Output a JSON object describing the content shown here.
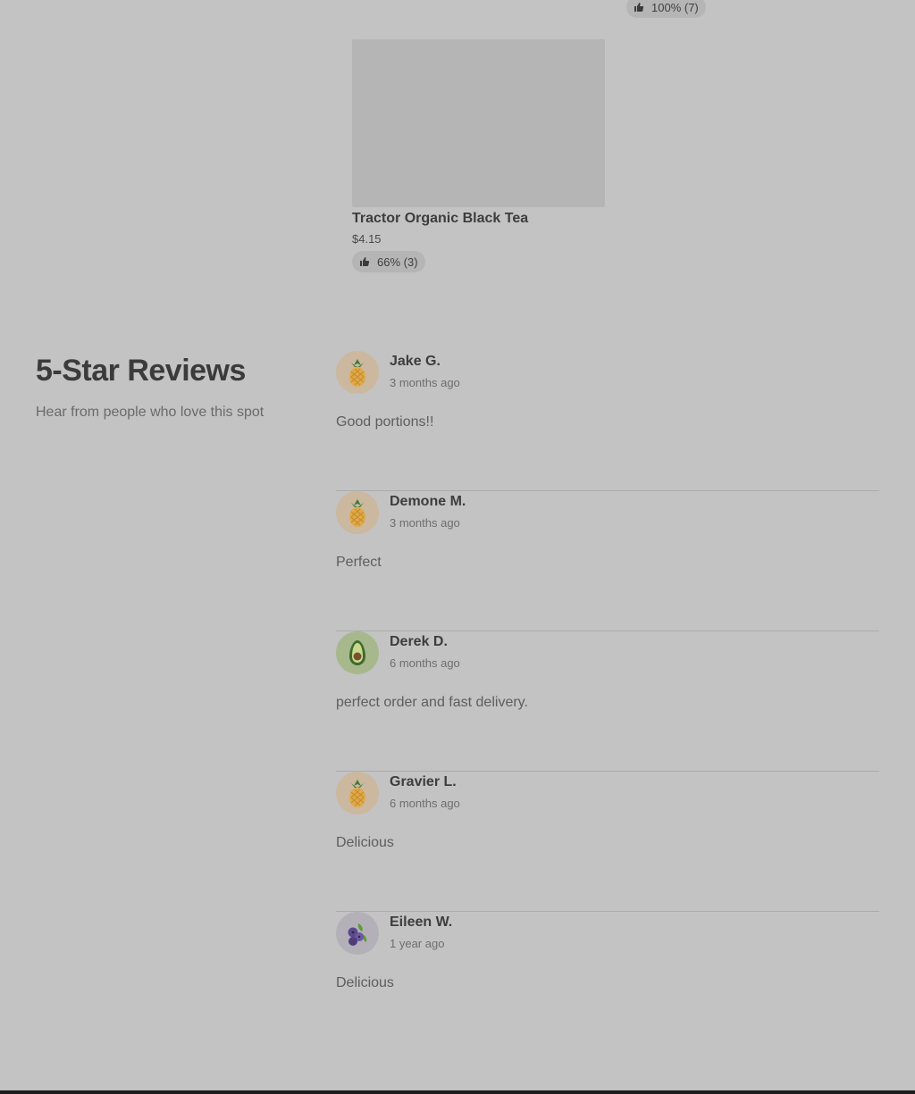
{
  "top_item": {
    "rating_text": "100% (7)"
  },
  "product": {
    "name": "Tractor Organic Black Tea",
    "price": "$4.15",
    "rating_text": "66% (3)"
  },
  "reviews_section": {
    "title": "5-Star Reviews",
    "subtitle": "Hear from people who love this spot",
    "reviews": [
      {
        "name": "Jake G.",
        "ago": "3 months ago",
        "text": "Good portions!!",
        "avatar": "pineapple-icon"
      },
      {
        "name": "Demone M.",
        "ago": "3 months ago",
        "text": "Perfect",
        "avatar": "pineapple-icon"
      },
      {
        "name": "Derek D.",
        "ago": "6 months ago",
        "text": "perfect order and fast delivery.",
        "avatar": "avocado-icon"
      },
      {
        "name": "Gravier L.",
        "ago": "6 months ago",
        "text": "Delicious",
        "avatar": "pineapple-icon"
      },
      {
        "name": "Eileen W.",
        "ago": "1 year ago",
        "text": "Delicious",
        "avatar": "blueberry-icon"
      }
    ]
  },
  "icons": {
    "thumb": "thumbs-up-icon"
  }
}
